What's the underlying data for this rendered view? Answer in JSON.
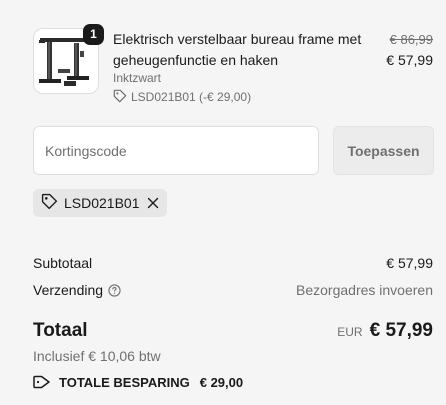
{
  "product": {
    "quantity": "1",
    "title": "Elektrisch verstelbaar bureau frame met geheugenfunctie en haken",
    "variant": "Inktzwart",
    "discount_tag": "LSD021B01 (-€ 29,00)",
    "price_original": "€ 86,99",
    "price_current": "€ 57,99"
  },
  "discount": {
    "placeholder": "Kortingscode",
    "apply_label": "Toepassen",
    "applied_code": "LSD021B01"
  },
  "summary": {
    "subtotal_label": "Subtotaal",
    "subtotal_value": "€ 57,99",
    "shipping_label": "Verzending",
    "shipping_value": "Bezorgadres invoeren",
    "total_label": "Totaal",
    "currency": "EUR",
    "total_value": "€ 57,99",
    "tax_note": "Inclusief € 10,06 btw",
    "savings_label": "TOTALE BESPARING",
    "savings_value": "€ 29,00"
  },
  "icons": {
    "tag": "tag-icon",
    "close": "close-icon",
    "help": "help-circle-icon"
  }
}
